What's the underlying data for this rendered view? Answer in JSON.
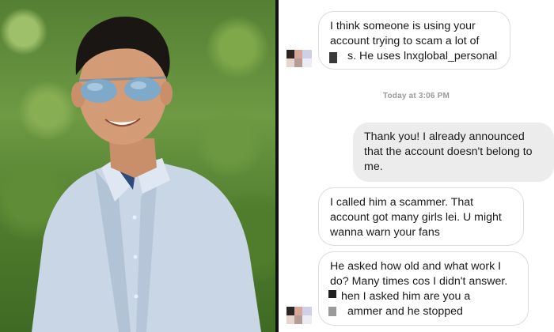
{
  "chat": {
    "timestamp": "Today at 3:06 PM",
    "messages": [
      {
        "side": "received",
        "lines": [
          "I think someone is using your",
          "account trying to scam a lot of",
          "s. He uses lnxglobal_personal"
        ]
      },
      {
        "side": "sent",
        "lines": [
          "Thank you! I already announced",
          "that the account doesn't belong to",
          "me."
        ]
      },
      {
        "side": "received",
        "lines": [
          "I called him a scammer. That",
          "account got many girls lei. U might",
          "wanna warn your fans"
        ]
      },
      {
        "side": "received",
        "lines": [
          "He asked how old and what work I",
          "do? Many times cos I didn't answer.",
          "hen I asked him are you a",
          "ammer and he stopped"
        ]
      }
    ]
  },
  "colors": {
    "sent_bubble": "#ececec",
    "received_border": "#dcdcdc",
    "timestamp_text": "#9a9a9a",
    "background_foliage": "#557f33",
    "divider": "#111111"
  }
}
